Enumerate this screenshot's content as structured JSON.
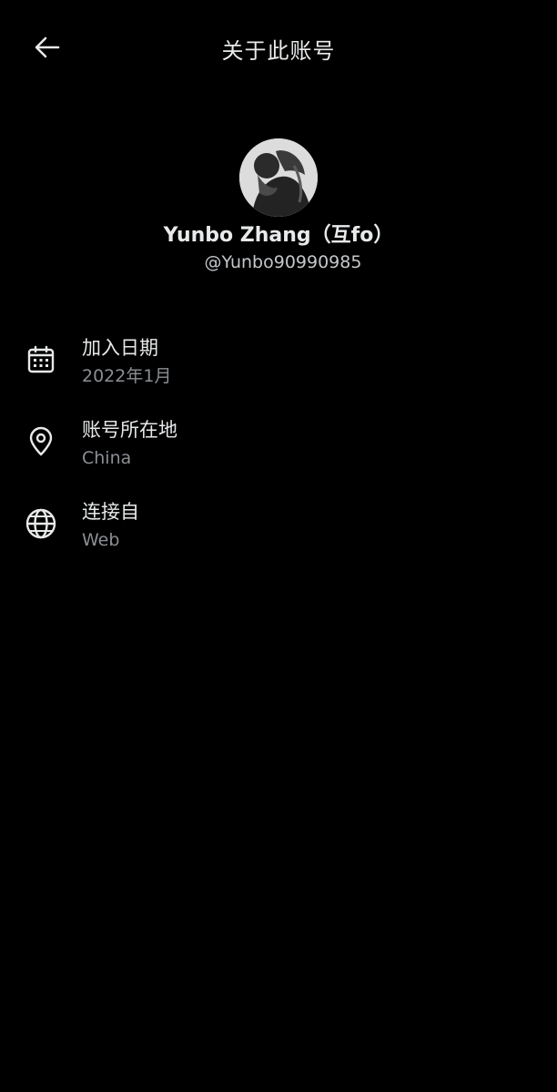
{
  "header": {
    "title": "关于此账号",
    "back_icon": "arrow-left-icon"
  },
  "profile": {
    "display_name": "Yunbo Zhang（互fo）",
    "handle": "@Yunbo90990985",
    "avatar_icon": "profile-avatar"
  },
  "info": [
    {
      "icon": "calendar-icon",
      "label": "加入日期",
      "value": "2022年1月"
    },
    {
      "icon": "location-pin-icon",
      "label": "账号所在地",
      "value": "China"
    },
    {
      "icon": "globe-icon",
      "label": "连接自",
      "value": "Web"
    }
  ],
  "colors": {
    "background": "#000000",
    "primary_text": "#e7e9ea",
    "secondary_text": "#8b8f94"
  }
}
